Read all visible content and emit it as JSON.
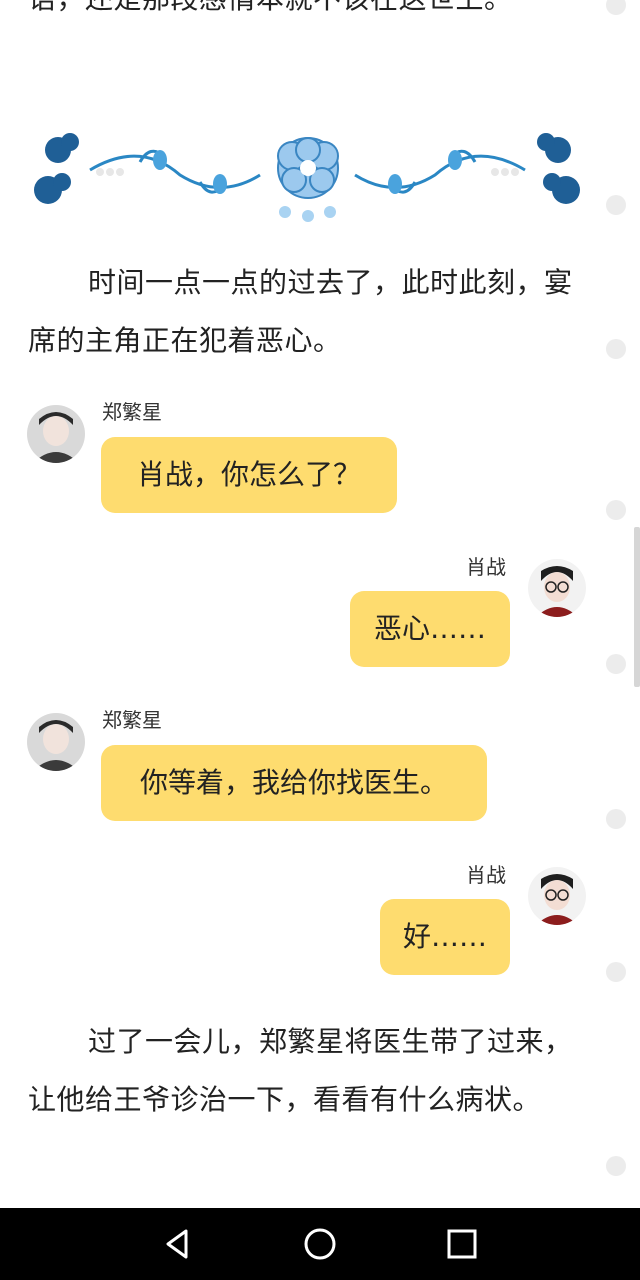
{
  "story": {
    "top_fragment": "语，还是那段感情本就不该在这世上。",
    "paragraph_1": "时间一点一点的过去了，此时此刻，宴席的主角正在犯着恶心。",
    "paragraph_2": "过了一会儿，郑繁星将医生带了过来，让他给王爷诊治一下，看看有什么病状。"
  },
  "chat": [
    {
      "side": "left",
      "name": "郑繁星",
      "text": "肖战，你怎么了？",
      "avatar": "portrait-avatar"
    },
    {
      "side": "right",
      "name": "肖战",
      "text": "恶心……",
      "avatar": "portrait-avatar"
    },
    {
      "side": "left",
      "name": "郑繁星",
      "text": "你等着，我给你找医生。",
      "avatar": "portrait-avatar"
    },
    {
      "side": "right",
      "name": "肖战",
      "text": "好……",
      "avatar": "portrait-avatar"
    }
  ],
  "navbar": {
    "buttons": [
      "back-icon",
      "home-icon",
      "recents-icon"
    ]
  },
  "colors": {
    "bubble": "#fedc6f",
    "ornament_blue": "#1f6fa8",
    "navbar": "#000000"
  }
}
